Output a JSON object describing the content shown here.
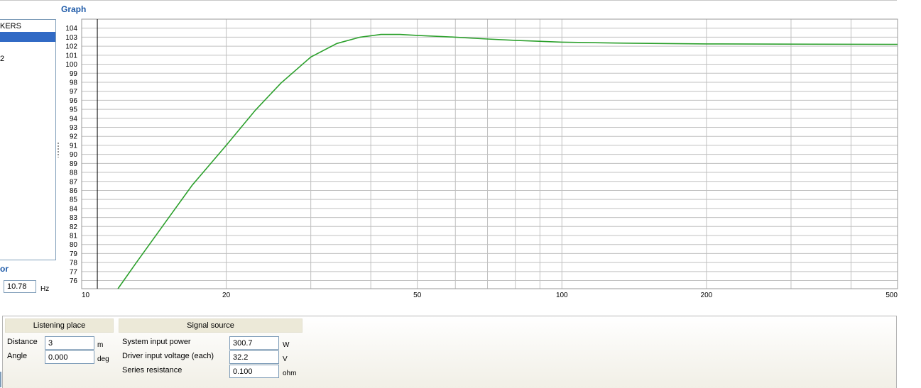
{
  "graph": {
    "title": "Graph"
  },
  "left_panel": {
    "items": [
      {
        "label": "KERS"
      },
      {
        "label": ""
      },
      {
        "label": "2"
      }
    ]
  },
  "frequency": {
    "section_label": "or",
    "value": "10.78",
    "unit": "Hz"
  },
  "listening_place": {
    "title": "Listening place",
    "distance": {
      "label": "Distance",
      "value": "3",
      "unit": "m"
    },
    "angle": {
      "label": "Angle",
      "value": "0.000",
      "unit": "deg"
    }
  },
  "signal_source": {
    "title": "Signal source",
    "power": {
      "label": "System input power",
      "value": "300.7",
      "unit": "W"
    },
    "voltage": {
      "label": "Driver input voltage (each)",
      "value": "32.2",
      "unit": "V"
    },
    "resistance": {
      "label": "Series resistance",
      "value": "0.100",
      "unit": "ohm"
    }
  },
  "chart_data": {
    "type": "line",
    "x_scale": "log",
    "xlim": [
      10,
      500
    ],
    "ylim": [
      75.1,
      105
    ],
    "x_tick_labels": [
      "10",
      "20",
      "50",
      "100",
      "200",
      "500"
    ],
    "x_ticks": [
      10,
      20,
      50,
      100,
      200,
      500
    ],
    "x_minor_ticks": [
      30,
      40,
      60,
      70,
      80,
      90,
      300,
      400
    ],
    "y_ticks": [
      76,
      77,
      78,
      79,
      80,
      81,
      82,
      83,
      84,
      85,
      86,
      87,
      88,
      89,
      90,
      91,
      92,
      93,
      94,
      95,
      96,
      97,
      98,
      99,
      100,
      101,
      102,
      103,
      104
    ],
    "grid": true,
    "cursor_x": 10.78,
    "series": [
      {
        "color": "#2ca02c",
        "points": [
          [
            11.9,
            75.1
          ],
          [
            13,
            78
          ],
          [
            15,
            82.6
          ],
          [
            17,
            86.6
          ],
          [
            20,
            91
          ],
          [
            23,
            94.9
          ],
          [
            26,
            97.9
          ],
          [
            30,
            100.8
          ],
          [
            34,
            102.3
          ],
          [
            38,
            103.0
          ],
          [
            42,
            103.3
          ],
          [
            46,
            103.3
          ],
          [
            50,
            103.2
          ],
          [
            60,
            103.0
          ],
          [
            70,
            102.8
          ],
          [
            80,
            102.65
          ],
          [
            100,
            102.45
          ],
          [
            130,
            102.35
          ],
          [
            200,
            102.25
          ],
          [
            500,
            102.2
          ]
        ]
      }
    ]
  }
}
